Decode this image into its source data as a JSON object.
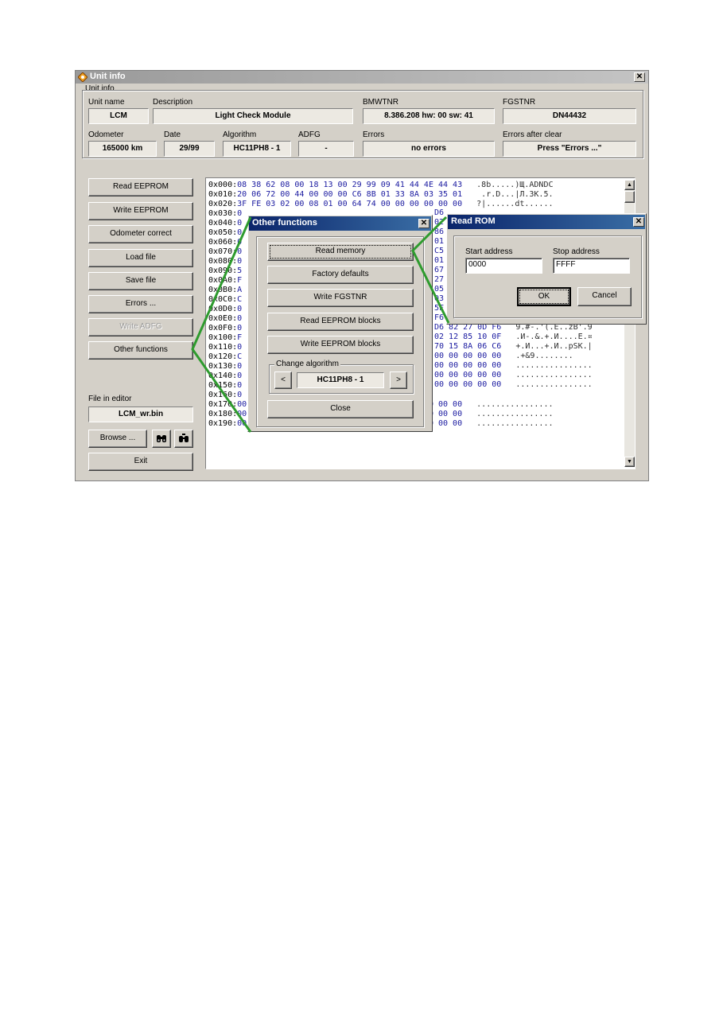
{
  "main_window": {
    "title": "Unit info",
    "close_glyph": "✕",
    "group_label": "Unit info",
    "fields": {
      "unit_name": {
        "label": "Unit name",
        "value": "LCM"
      },
      "description": {
        "label": "Description",
        "value": "Light Check Module"
      },
      "bmwtnr": {
        "label": "BMWTNR",
        "value": "8.386.208   hw: 00   sw: 41"
      },
      "fgstnr": {
        "label": "FGSTNR",
        "value": "DN44432"
      },
      "odometer": {
        "label": "Odometer",
        "value": "165000 km"
      },
      "date": {
        "label": "Date",
        "value": "29/99"
      },
      "algorithm": {
        "label": "Algorithm",
        "value": "HC11PH8 - 1"
      },
      "adfg": {
        "label": "ADFG",
        "value": "-"
      },
      "errors": {
        "label": "Errors",
        "value": "no errors"
      },
      "errors_after_clear": {
        "label": "Errors after clear",
        "value": "Press \"Errors ...\""
      }
    },
    "buttons": {
      "read_eeprom": "Read EEPROM",
      "write_eeprom": "Write EEPROM",
      "odometer_correct": "Odometer correct",
      "load_file": "Load file",
      "save_file": "Save file",
      "errors": "Errors ...",
      "write_adfg": "Write ADFG",
      "other_functions": "Other functions",
      "browse": "Browse ...",
      "exit": "Exit"
    },
    "file_in_editor": {
      "label": "File in editor",
      "value": "LCM_wr.bin"
    }
  },
  "hex_rows": [
    {
      "addr": "0x000:",
      "bytes": "08 38 62 08 00 18 13 00 29 99 09 41 44 4E 44 43",
      "ascii": " .8b.....)Щ.ADNDC"
    },
    {
      "addr": "0x010:",
      "bytes": "20 06 72 00 44 00 00 00 C6 8B 01 33 8A 03 35 01",
      "ascii": "  .r.D...|Л.3К.5."
    },
    {
      "addr": "0x020:",
      "bytes": "3F FE 03 02 00 08 01 00 64 74 00 00 00 00 00 00",
      "ascii": " ?|......dt......"
    },
    {
      "addr": "0x030:",
      "bytes": "0",
      "ascii": ""
    },
    {
      "addr": "0x040:",
      "bytes": "0",
      "ascii": ""
    },
    {
      "addr": "0x050:",
      "bytes": "0",
      "ascii": ""
    },
    {
      "addr": "0x060:",
      "bytes": "0",
      "ascii": ""
    },
    {
      "addr": "0x070:",
      "bytes": "0",
      "ascii": ""
    },
    {
      "addr": "0x080:",
      "bytes": "0",
      "ascii": ""
    },
    {
      "addr": "0x090:",
      "bytes": "5",
      "ascii": ""
    },
    {
      "addr": "0x0A0:",
      "bytes": "F",
      "ascii": ""
    },
    {
      "addr": "0x0B0:",
      "bytes": "A",
      "ascii": ""
    },
    {
      "addr": "0x0C0:",
      "bytes": "C",
      "ascii": ""
    },
    {
      "addr": "0x0D0:",
      "bytes": "0",
      "ascii": ""
    },
    {
      "addr": "0x0E0:",
      "bytes": "0",
      "ascii": ""
    },
    {
      "addr": "0x0F0:",
      "bytes": "0",
      "ascii": ""
    },
    {
      "addr": "0x100:",
      "bytes": "F",
      "ascii": ""
    },
    {
      "addr": "0x110:",
      "bytes": "0",
      "ascii": ""
    },
    {
      "addr": "0x120:",
      "bytes": "C",
      "ascii": ""
    },
    {
      "addr": "0x130:",
      "bytes": "0",
      "ascii": ""
    },
    {
      "addr": "0x140:",
      "bytes": "0",
      "ascii": ""
    },
    {
      "addr": "0x150:",
      "bytes": "0",
      "ascii": ""
    },
    {
      "addr": "0x160:",
      "bytes": "0",
      "ascii": ""
    },
    {
      "addr": "0x170:",
      "bytes": "00 00 00 00 00 00 00 00 00 00 00 00 00 00 00 00",
      "ascii": " ................"
    },
    {
      "addr": "0x180:",
      "bytes": "00 00 00 00 00 00 00 00 00 00 00 00 00 00 00 00",
      "ascii": " ................"
    },
    {
      "addr": "0x190:",
      "bytes": "00 00 00 00 00 00 00 00 00 00 00 00 00 00 00 00",
      "ascii": " ................"
    }
  ],
  "hex_right_fragments": [
    {
      "bytes": "D6",
      "ascii": ""
    },
    {
      "bytes": "02",
      "ascii": ""
    },
    {
      "bytes": "86",
      "ascii": ""
    },
    {
      "bytes": "01",
      "ascii": ""
    },
    {
      "bytes": "C5",
      "ascii": ""
    },
    {
      "bytes": "01",
      "ascii": ""
    },
    {
      "bytes": "67",
      "ascii": ""
    },
    {
      "bytes": "27",
      "ascii": ""
    },
    {
      "bytes": "05",
      "ascii": ""
    },
    {
      "bytes": "03 14 8B 04 F6",
      "ascii": " ..9..9.#=...ЙЛ.9"
    },
    {
      "bytes": "5F F7 05 40 F7",
      "ascii": " .&-.'S9.@'._9.@9"
    },
    {
      "bytes": "F6 0D 23 2C 2F",
      "ascii": " .pzМ&.| 9.@9.#,/"
    },
    {
      "bytes": "D6 82 27 0D F6",
      "ascii": " 9.#-.'(.E..zB'.9"
    },
    {
      "bytes": "02 12 85 10 0F",
      "ascii": " .И-.&.+.И....E.¤"
    },
    {
      "bytes": "70 15 8A 06 C6",
      "ascii": " +.И...+.И..pSK.|"
    },
    {
      "bytes": "00 00 00 00 00",
      "ascii": " .+&9........"
    },
    {
      "bytes": "00 00 00 00 00",
      "ascii": " ................"
    },
    {
      "bytes": "00 00 00 00 00",
      "ascii": " ................"
    },
    {
      "bytes": "00 00 00 00 00",
      "ascii": " ................"
    }
  ],
  "other_functions_dialog": {
    "title": "Other functions",
    "close_glyph": "✕",
    "buttons": {
      "read_memory": "Read memory",
      "factory_defaults": "Factory defaults",
      "write_fgstnr": "Write FGSTNR",
      "read_eeprom_blocks": "Read EEPROM blocks",
      "write_eeprom_blocks": "Write EEPROM blocks",
      "close": "Close"
    },
    "change_algorithm": {
      "label": "Change algorithm",
      "prev": "<",
      "next": ">",
      "value": "HC11PH8 - 1"
    }
  },
  "read_rom_dialog": {
    "title": "Read ROM",
    "close_glyph": "✕",
    "start_label": "Start address",
    "start_value": "0000",
    "stop_label": "Stop address",
    "stop_value": "FFFF",
    "ok": "OK",
    "cancel": "Cancel"
  },
  "scroll": {
    "up": "▲",
    "down": "▼"
  },
  "colors": {
    "title_active": "#0a246a",
    "highlight_line": "#2e9b2e",
    "hex_bytes": "#1a1aa0"
  }
}
